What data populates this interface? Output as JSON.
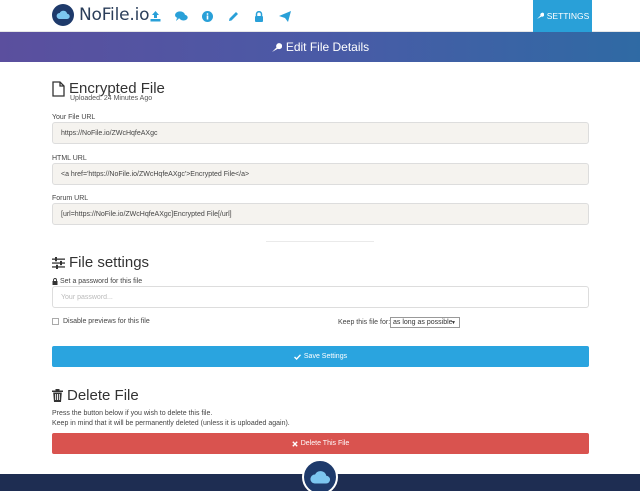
{
  "header": {
    "brand": "NoFile.io",
    "settings_label": "SETTINGS",
    "nav_icons": [
      "upload-icon",
      "comments-icon",
      "info-icon",
      "pencil-icon",
      "lock-icon",
      "paper-plane-icon"
    ]
  },
  "banner": {
    "title": "Edit File Details"
  },
  "file": {
    "name": "Encrypted File",
    "uploaded": "Uploaded: 24 Minutes Ago",
    "url_label": "Your File URL",
    "url_value": "https://NoFile.io/ZWcHqfeAXgc",
    "html_label": "HTML URL",
    "html_value": "<a href='https://NoFile.io/ZWcHqfeAXgc'>Encrypted File</a>",
    "forum_label": "Forum URL",
    "forum_value": "[url=https://NoFile.io/ZWcHqfeAXgc]Encrypted File[/url]"
  },
  "settings": {
    "title": "File settings",
    "password_label": "Set a password for this file",
    "password_placeholder": "Your password...",
    "disable_previews_label": "Disable previews for this file",
    "keep_label": "Keep this file for:",
    "keep_value": "as long as possible",
    "save_label": "Save Settings"
  },
  "delete": {
    "title": "Delete File",
    "line1": "Press the button below if you wish to delete this file.",
    "line2": "Keep in mind that it will be permanently deleted (unless it is uploaded again).",
    "button_label": "Delete This File"
  },
  "colors": {
    "accent": "#29a0d8",
    "danger": "#d9534f",
    "footer": "#1e2d52"
  }
}
